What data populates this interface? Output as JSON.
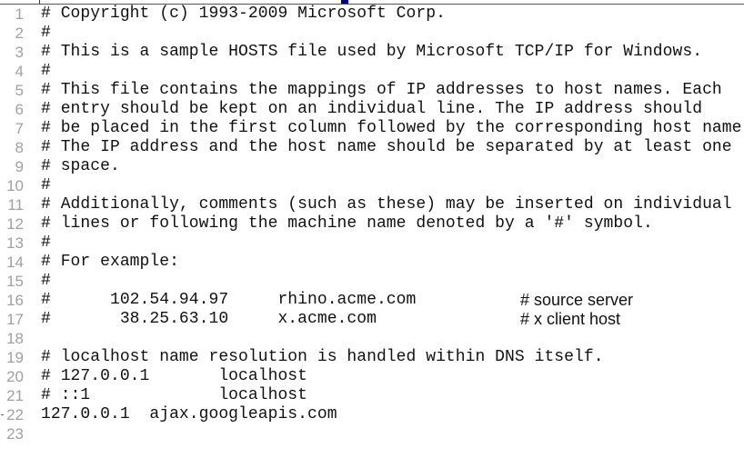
{
  "editor": {
    "lines": [
      {
        "number": "1",
        "text": "# Copyright (c) 1993-2009 Microsoft Corp.",
        "trailing": ""
      },
      {
        "number": "2",
        "text": "#",
        "trailing": ""
      },
      {
        "number": "3",
        "text": "# This is a sample HOSTS file used by Microsoft TCP/IP for Windows.",
        "trailing": ""
      },
      {
        "number": "4",
        "text": "#",
        "trailing": ""
      },
      {
        "number": "5",
        "text": "# This file contains the mappings of IP addresses to host names. Each",
        "trailing": ""
      },
      {
        "number": "6",
        "text": "# entry should be kept on an individual line. The IP address should",
        "trailing": ""
      },
      {
        "number": "7",
        "text": "# be placed in the first column followed by the corresponding host name.",
        "trailing": ""
      },
      {
        "number": "8",
        "text": "# The IP address and the host name should be separated by at least one",
        "trailing": ""
      },
      {
        "number": "9",
        "text": "# space.",
        "trailing": ""
      },
      {
        "number": "10",
        "text": "#",
        "trailing": ""
      },
      {
        "number": "11",
        "text": "# Additionally, comments (such as these) may be inserted on individual",
        "trailing": ""
      },
      {
        "number": "12",
        "text": "# lines or following the machine name denoted by a '#' symbol.",
        "trailing": ""
      },
      {
        "number": "13",
        "text": "#",
        "trailing": ""
      },
      {
        "number": "14",
        "text": "# For example:",
        "trailing": ""
      },
      {
        "number": "15",
        "text": "#",
        "trailing": ""
      },
      {
        "number": "16",
        "text": "#      102.54.94.97     rhino.acme.com",
        "trailing": "# source server"
      },
      {
        "number": "17",
        "text": "#       38.25.63.10     x.acme.com",
        "trailing": "# x client host"
      },
      {
        "number": "18",
        "text": "",
        "trailing": ""
      },
      {
        "number": "19",
        "text": "# localhost name resolution is handled within DNS itself.",
        "trailing": ""
      },
      {
        "number": "20",
        "text": "# 127.0.0.1       localhost",
        "trailing": ""
      },
      {
        "number": "21",
        "text": "# ::1             localhost",
        "trailing": ""
      },
      {
        "number": "22",
        "text": "127.0.0.1  ajax.googleapis.com",
        "trailing": ""
      },
      {
        "number": "23",
        "text": "",
        "trailing": ""
      }
    ]
  }
}
